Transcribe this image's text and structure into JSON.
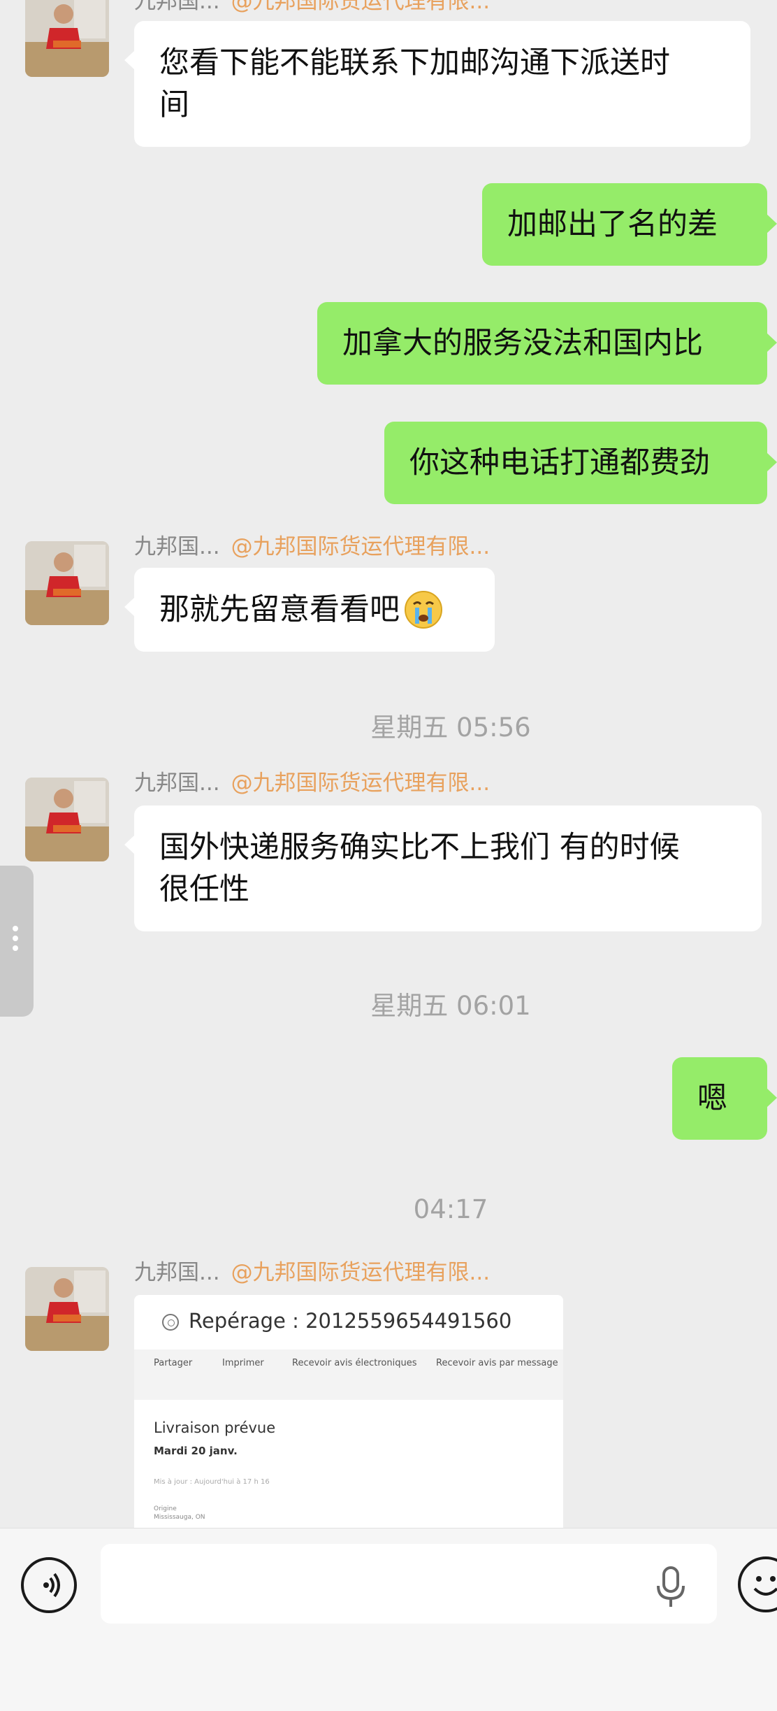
{
  "chat": {
    "messages": [
      {
        "kind": "in",
        "sender": "九邦国...",
        "group_tag": "@九邦国际货运代理有限...",
        "text": "您看下能不能联系下加邮沟通下派送时\n间"
      },
      {
        "kind": "out",
        "text": "加邮出了名的差"
      },
      {
        "kind": "out",
        "text": "加拿大的服务没法和国内比"
      },
      {
        "kind": "out",
        "text": "你这种电话打通都费劲"
      },
      {
        "kind": "in",
        "sender": "九邦国...",
        "group_tag": "@九邦国际货运代理有限...",
        "text": "那就先留意看看吧",
        "emoji": "crying-face"
      },
      {
        "kind": "time",
        "text": "星期五 05:56"
      },
      {
        "kind": "in",
        "sender": "九邦国...",
        "group_tag": "@九邦国际货运代理有限...",
        "text": "国外快递服务确实比不上我们 有的时候\n很任性"
      },
      {
        "kind": "time",
        "text": "星期五 06:01"
      },
      {
        "kind": "out",
        "text": "嗯"
      },
      {
        "kind": "time",
        "text": "04:17"
      },
      {
        "kind": "in-image",
        "sender": "九邦国...",
        "group_tag": "@九邦国际货运代理有限..."
      }
    ],
    "image_card": {
      "tracking_label": "Repérage : 2012559654491560",
      "actions": [
        "Partager",
        "Imprimer",
        "Recevoir avis électroniques",
        "Recevoir avis par message"
      ],
      "delivery_heading": "Livraison prévue",
      "delivery_date": "Mardi 20 janv.",
      "updated_note": "Mis à jour : Aujourd'hui à 17 h 16",
      "origin_label": "Origine",
      "origin_value": "Mississauga, ON"
    }
  },
  "colors": {
    "incoming": "#ffffff",
    "outgoing": "#95ec69",
    "background": "#ededed",
    "group_tag": "#e8a15d",
    "timestamp": "#a3a3a3"
  },
  "input_bar": {
    "voice_icon": "voice-mode-icon",
    "mic_icon": "microphone-icon",
    "emoji_icon": "emoji-smile-icon"
  }
}
